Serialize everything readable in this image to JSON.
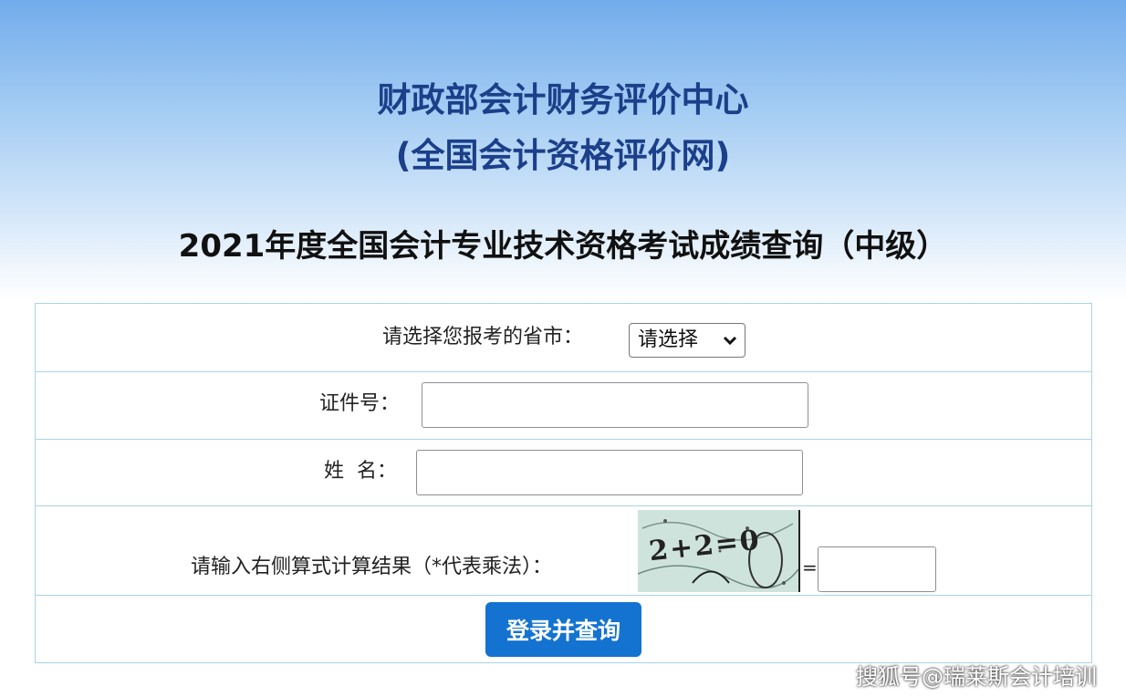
{
  "header": {
    "org_line1": "财政部会计财务评价中心",
    "org_line2": "(全国会计资格评价网)",
    "exam_title": "2021年度全国会计专业技术资格考试成绩查询（中级）"
  },
  "form": {
    "province_label": "请选择您报考的省市：",
    "province_select_value": "请选择",
    "id_label": "证件号：",
    "id_value": "",
    "name_label": "姓  名：",
    "name_value": "",
    "captcha_label": "请输入右侧算式计算结果（*代表乘法）：",
    "captcha_text": "2+2=0",
    "equals_sign": "=",
    "captcha_value": "",
    "submit_label": "登录并查询"
  },
  "watermark": "搜狐号@瑞莱斯会计培训",
  "colors": {
    "org_title": "#1c3f8a",
    "button": "#1473d0",
    "border": "#a9d3e8"
  }
}
